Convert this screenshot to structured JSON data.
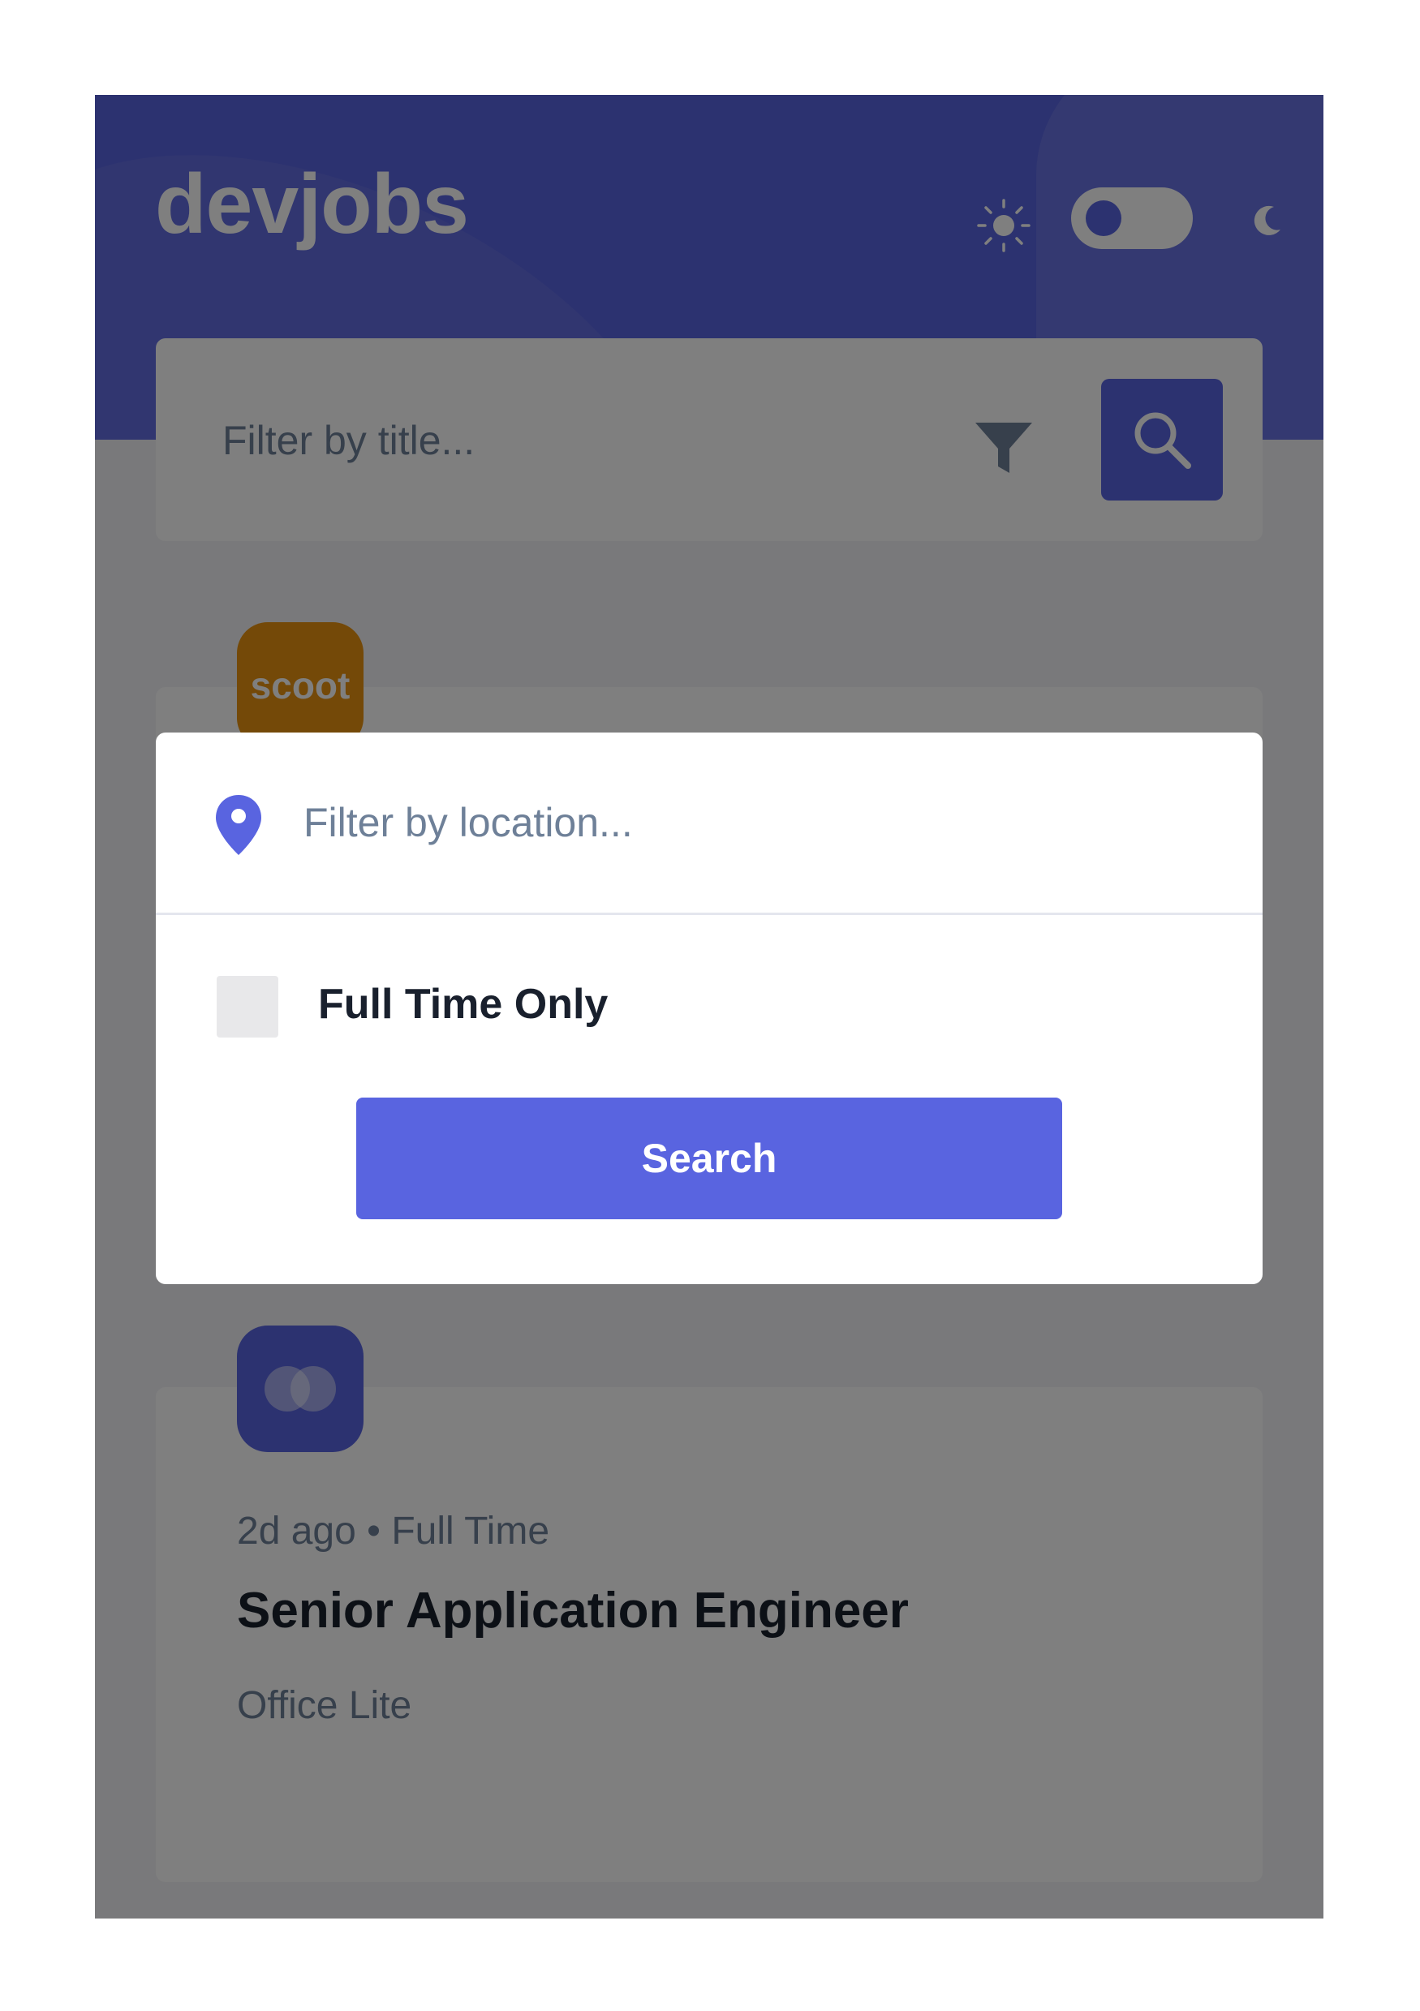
{
  "app": {
    "logo": "devjobs"
  },
  "theme_switch": {
    "sun_icon": "sun-icon",
    "moon_icon": "moon-icon",
    "state": "light"
  },
  "search": {
    "title_placeholder": "Filter by title...",
    "filter_icon": "filter-icon",
    "search_icon": "search-icon"
  },
  "jobs": [
    {
      "logo_text": "scoot",
      "logo_color": "#e99210"
    },
    {
      "logo_icon": "office-lite-logo",
      "logo_color": "#5964e0",
      "posted": "2d ago",
      "separator": "•",
      "contract": "Full Time",
      "title": "Senior Application Engineer",
      "company": "Office Lite"
    }
  ],
  "filter_modal": {
    "location_icon": "location-pin-icon",
    "location_placeholder": "Filter by location...",
    "full_time_label": "Full Time Only",
    "full_time_checked": false,
    "search_button": "Search"
  },
  "colors": {
    "accent": "#5964e0",
    "background": "#f2f3f7",
    "text_dark": "#19202d",
    "text_muted": "#6e8098",
    "scoot": "#e99210"
  }
}
